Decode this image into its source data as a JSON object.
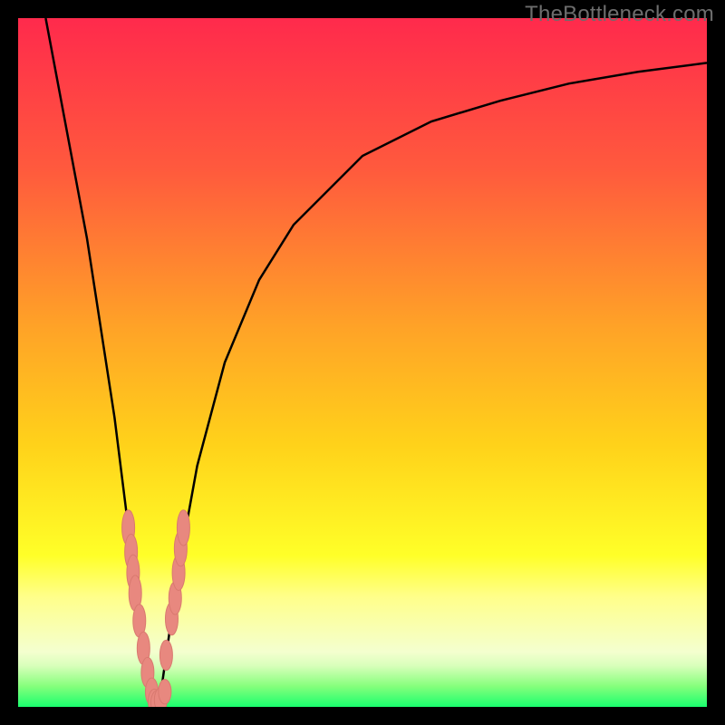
{
  "watermark": "TheBottleneck.com",
  "colors": {
    "frame": "#000000",
    "curve": "#000000",
    "marker_fill": "#e8887f",
    "marker_stroke": "#d9796f",
    "gradient_stops": [
      {
        "offset": 0,
        "color": "#ff2a4c"
      },
      {
        "offset": 0.22,
        "color": "#ff5a3d"
      },
      {
        "offset": 0.45,
        "color": "#ffa327"
      },
      {
        "offset": 0.62,
        "color": "#ffd21a"
      },
      {
        "offset": 0.78,
        "color": "#ffff28"
      },
      {
        "offset": 0.84,
        "color": "#ffff8a"
      },
      {
        "offset": 0.92,
        "color": "#f4ffcf"
      },
      {
        "offset": 0.94,
        "color": "#d9ffbb"
      },
      {
        "offset": 0.97,
        "color": "#86ff7c"
      },
      {
        "offset": 1.0,
        "color": "#1aff6e"
      }
    ]
  },
  "chart_data": {
    "type": "line",
    "title": "",
    "xlabel": "",
    "ylabel": "",
    "xlim": [
      0,
      100
    ],
    "ylim": [
      0,
      100
    ],
    "grid": false,
    "series": [
      {
        "name": "curve",
        "x": [
          4,
          7,
          10,
          12,
          14,
          15,
          16,
          17,
          18,
          19,
          19.5,
          20,
          20.5,
          21,
          22,
          24,
          26,
          30,
          35,
          40,
          50,
          60,
          70,
          80,
          90,
          100
        ],
        "y": [
          100,
          84,
          68,
          55,
          42,
          34,
          26,
          18,
          10,
          5,
          2,
          0,
          1,
          4,
          11,
          24,
          35,
          50,
          62,
          70,
          80,
          85,
          88,
          90.5,
          92.2,
          93.5
        ]
      }
    ],
    "markers_note": "Small pill/oval markers clustered near the trough of the V curve",
    "markers": [
      {
        "x": 16.0,
        "y": 26.0,
        "ry": 1.8
      },
      {
        "x": 16.4,
        "y": 22.5,
        "ry": 1.8
      },
      {
        "x": 16.7,
        "y": 19.5,
        "ry": 1.8
      },
      {
        "x": 17.0,
        "y": 16.5,
        "ry": 1.8
      },
      {
        "x": 17.6,
        "y": 12.5,
        "ry": 1.6
      },
      {
        "x": 18.2,
        "y": 8.5,
        "ry": 1.6
      },
      {
        "x": 18.8,
        "y": 5.0,
        "ry": 1.4
      },
      {
        "x": 19.4,
        "y": 2.2,
        "ry": 1.2
      },
      {
        "x": 19.8,
        "y": 0.8,
        "ry": 1.0
      },
      {
        "x": 20.2,
        "y": 0.6,
        "ry": 1.0
      },
      {
        "x": 20.7,
        "y": 1.0,
        "ry": 1.0
      },
      {
        "x": 21.3,
        "y": 2.2,
        "ry": 1.0
      },
      {
        "x": 21.5,
        "y": 7.5,
        "ry": 1.4
      },
      {
        "x": 22.3,
        "y": 12.8,
        "ry": 1.6
      },
      {
        "x": 22.8,
        "y": 15.8,
        "ry": 1.6
      },
      {
        "x": 23.3,
        "y": 19.5,
        "ry": 1.8
      },
      {
        "x": 23.6,
        "y": 23.0,
        "ry": 1.8
      },
      {
        "x": 24.0,
        "y": 26.0,
        "ry": 1.8
      }
    ]
  }
}
